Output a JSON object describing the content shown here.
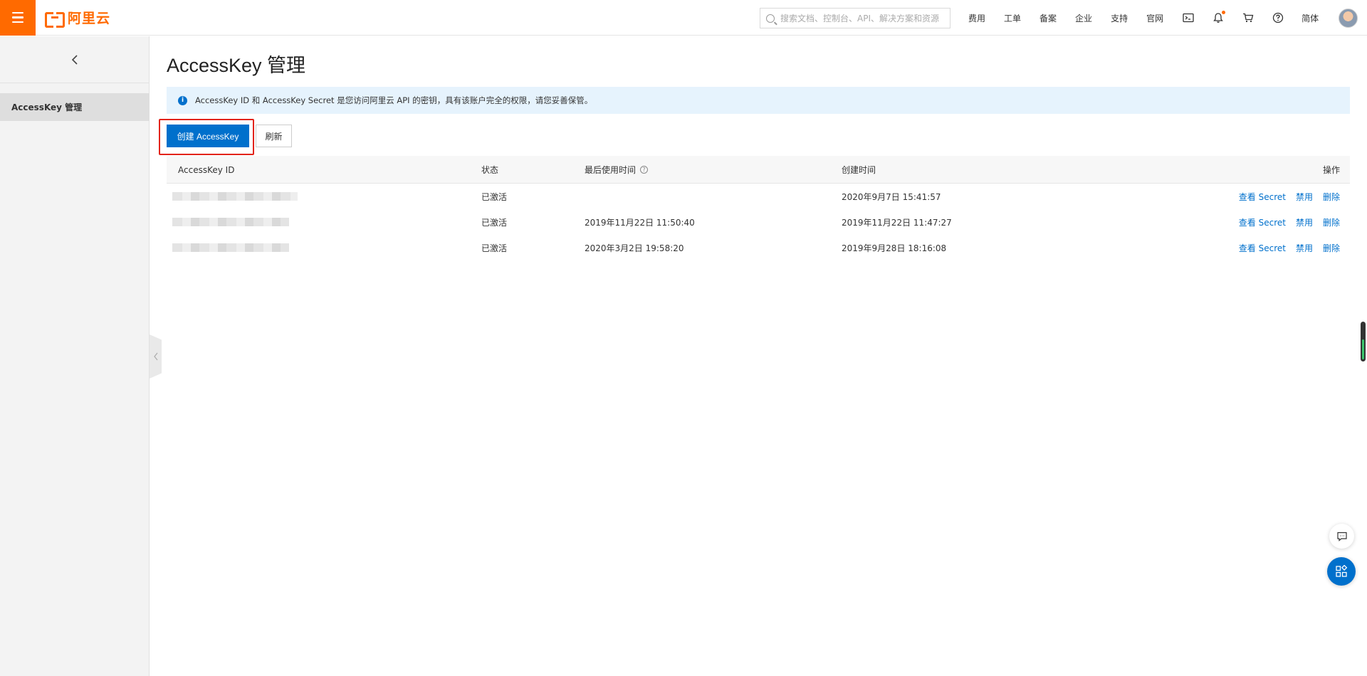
{
  "header": {
    "logo_text": "阿里云",
    "search_placeholder": "搜索文档、控制台、API、解决方案和资源",
    "nav": [
      "费用",
      "工单",
      "备案",
      "企业",
      "支持",
      "官网"
    ],
    "lang": "简体",
    "accent_color": "#ff6a00",
    "icons": [
      "terminal-icon",
      "bell-icon",
      "cart-icon",
      "help-icon"
    ]
  },
  "sidebar": {
    "items": [
      {
        "label": "AccessKey 管理",
        "active": true
      }
    ]
  },
  "main": {
    "title": "AccessKey 管理",
    "notice": "AccessKey ID 和 AccessKey Secret 是您访问阿里云 API 的密钥，具有该账户完全的权限，请您妥善保管。",
    "buttons": {
      "create": "创建 AccessKey",
      "refresh": "刷新"
    },
    "table": {
      "columns": [
        "AccessKey ID",
        "状态",
        "最后使用时间",
        "创建时间",
        "操作"
      ],
      "rows": [
        {
          "status": "已激活",
          "last_used": "",
          "created": "2020年9月7日 15:41:57",
          "ops": [
            "查看 Secret",
            "禁用",
            "删除"
          ]
        },
        {
          "status": "已激活",
          "last_used": "2019年11月22日 11:50:40",
          "created": "2019年11月22日 11:47:27",
          "ops": [
            "查看 Secret",
            "禁用",
            "删除"
          ]
        },
        {
          "status": "已激活",
          "last_used": "2020年3月2日 19:58:20",
          "created": "2019年9月28日 18:16:08",
          "ops": [
            "查看 Secret",
            "禁用",
            "删除"
          ]
        }
      ]
    },
    "primary_color": "#0070cc"
  }
}
